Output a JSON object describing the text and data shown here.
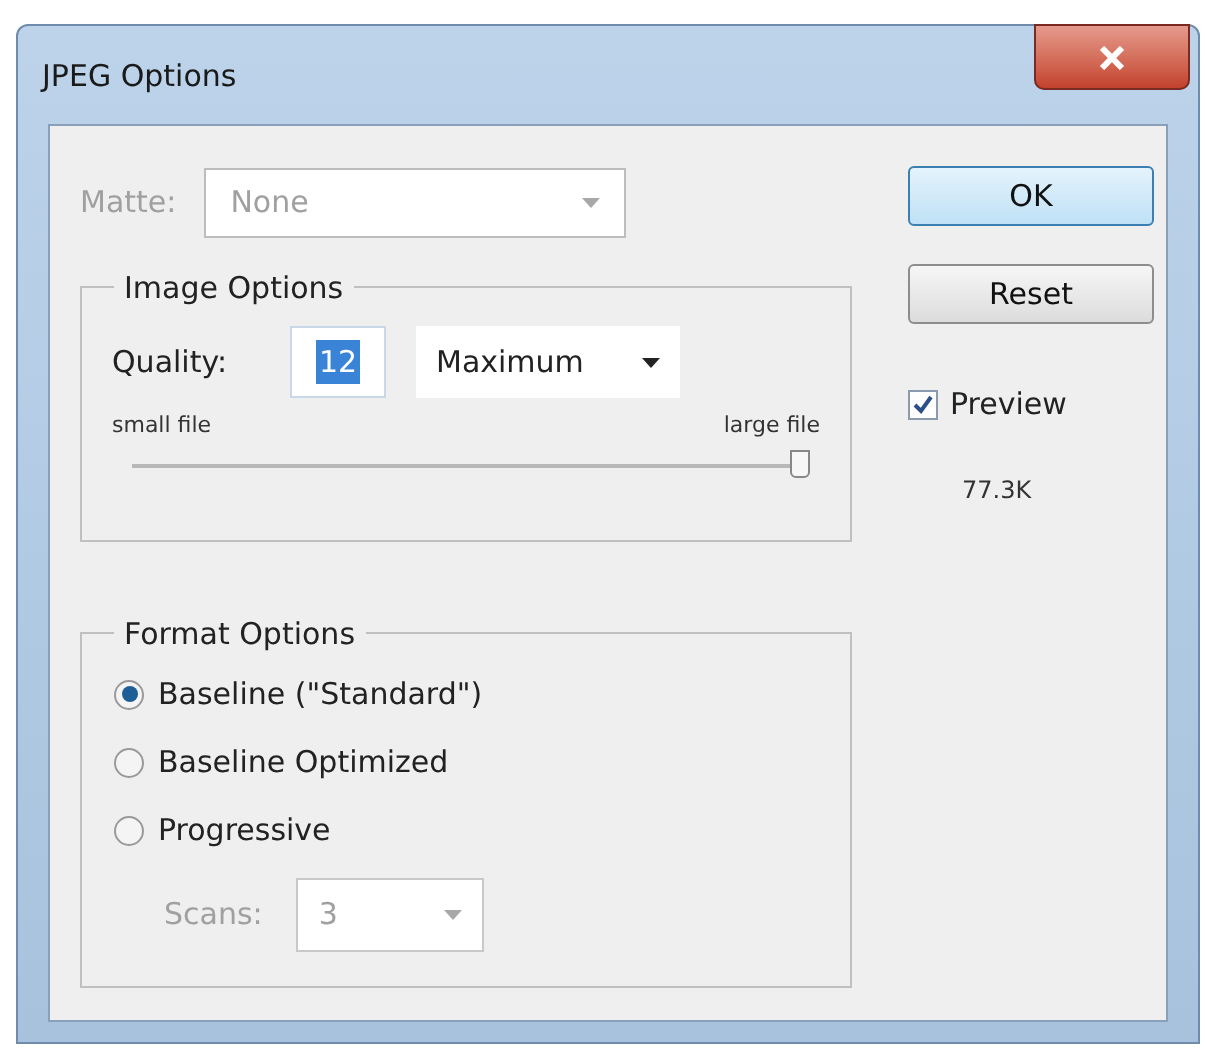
{
  "window": {
    "title": "JPEG Options"
  },
  "matte": {
    "label": "Matte:",
    "value": "None",
    "disabled": true
  },
  "image_options": {
    "title": "Image Options",
    "quality_label": "Quality:",
    "quality_value": "12",
    "quality_preset": "Maximum",
    "small_label": "small file",
    "large_label": "large file",
    "level": 1.0
  },
  "format_options": {
    "title": "Format Options",
    "radios": [
      {
        "label": "Baseline (\"Standard\")",
        "selected": true
      },
      {
        "label": "Baseline Optimized",
        "selected": false
      },
      {
        "label": "Progressive",
        "selected": false
      }
    ],
    "scans": {
      "label": "Scans:",
      "value": "3",
      "disabled": true
    }
  },
  "buttons": [
    {
      "label": "OK",
      "default": true
    },
    {
      "label": "Reset",
      "default": false
    }
  ],
  "preview": {
    "label": "Preview",
    "checked": true
  },
  "file_size": "77.3K"
}
